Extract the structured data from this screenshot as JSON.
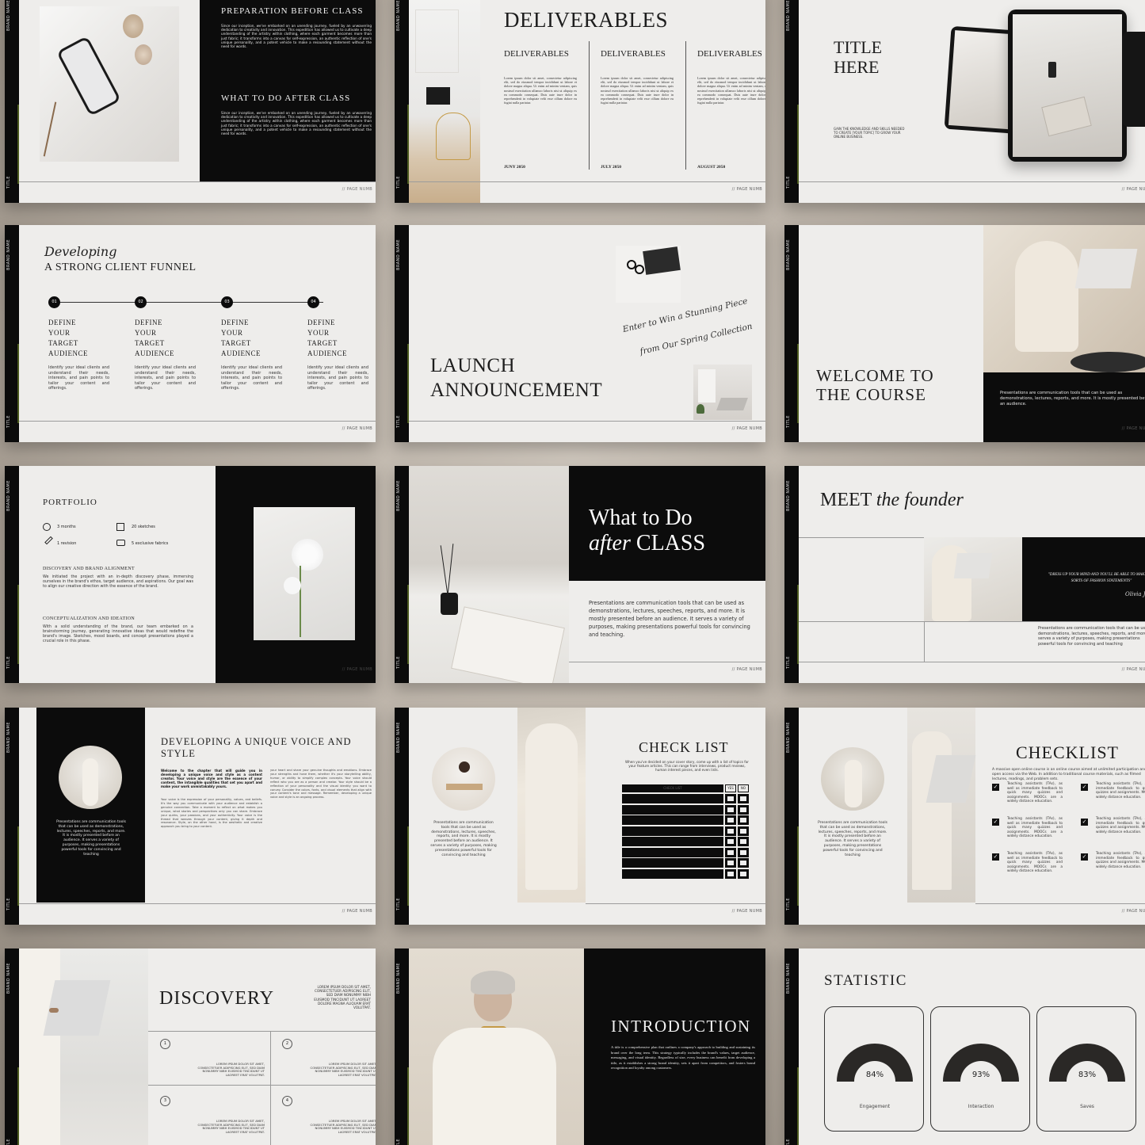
{
  "common": {
    "brand": "BRAND NAME",
    "title": "TITLE",
    "page": "// PAGE NUMB"
  },
  "s1": {
    "h1": "PREPARATION BEFORE CLASS",
    "h2": "WHAT TO DO AFTER CLASS",
    "body": "Since our inception, we've embarked on an unending journey, fueled by an unwavering dedication to creativity and innovation. This expedition has allowed us to cultivate a deep understanding of the artistry within clothing, where each garment becomes more than just fabric; it transforms into a canvas for self-expression, an authentic reflection of one's unique personality, and a potent vehicle to make a resounding statement without the need for words."
  },
  "s2": {
    "title": "DELIVERABLES",
    "cols": [
      {
        "h": "DELIVERABLES",
        "date": "JUNY 2050"
      },
      {
        "h": "DELIVERABLES",
        "date": "JULY 2050"
      },
      {
        "h": "DELIVERABLES",
        "date": "AUGUST 2050"
      }
    ],
    "body": "Lorem ipsum dolor sit amet, consectetur adipiscing elit, sed do eiusmod tempor incididunt ut labore et dolore magna aliqua. Ut enim ad minim veniam, quis nostrud exercitation ullamco laboris nisi ut aliquip ex ea commodo consequat. Duis aute irure dolor in reprehenderit in voluptate velit esse cillum dolore eu fugiat nulla pariatur."
  },
  "s3": {
    "title1": "TITLE",
    "title2": "HERE",
    "body": "GAIN THE KNOWLEDGE AND SKILLS NEEDED TO CREATE [YOUR TOPIC] TO GROW YOUR ONLINE BUSINESS."
  },
  "s4": {
    "script": "Developing",
    "title": "A STRONG CLIENT FUNNEL",
    "steps": [
      {
        "n": "01",
        "h": "DEFINE YOUR TARGET AUDIENCE",
        "b": "Identify your ideal clients and understand their needs, interests, and pain points to tailor your content and offerings."
      },
      {
        "n": "02",
        "h": "DEFINE YOUR TARGET AUDIENCE",
        "b": "Identify your ideal clients and understand their needs, interests, and pain points to tailor your content and offerings."
      },
      {
        "n": "03",
        "h": "DEFINE YOUR TARGET AUDIENCE",
        "b": "Identify your ideal clients and understand their needs, interests, and pain points to tailor your content and offerings."
      },
      {
        "n": "04",
        "h": "DEFINE YOUR TARGET AUDIENCE",
        "b": "Identify your ideal clients and understand their needs, interests, and pain points to tailor your content and offerings."
      }
    ]
  },
  "s5": {
    "title1": "LAUNCH",
    "title2": "ANNOUNCEMENT",
    "script1": "Enter to Win a Stunning Piece",
    "script2": "from Our Spring Collection"
  },
  "s6": {
    "title1": "WELCOME TO",
    "title2": "THE COURSE",
    "body": "Presentations are communication tools that can be used as demonstrations, lectures, reports, and more. It is mostly presented before an audience."
  },
  "s7": {
    "title": "PORTFOLIO",
    "stats": [
      "3 months",
      "20 sketches",
      "1 revision",
      "5 exclusive fabrics"
    ],
    "h1": "DISCOVERY AND BRAND ALIGNMENT",
    "b1": "We initiated the project with an in-depth discovery phase, immersing ourselves in the brand's ethos, target audience, and aspirations. Our goal was to align our creative direction with the essence of the brand.",
    "h2": "CONCEPTUALIZATION AND IDEATION",
    "b2": "With a solid understanding of the brand, our team embarked on a brainstorming journey, generating innovative ideas that would redefine the brand's image. Sketches, mood boards, and concept presentations played a crucial role in this phase."
  },
  "s8": {
    "t1": "What to Do",
    "t2a": "after",
    "t2b": " CLASS",
    "body": "Presentations are communication tools that can be used as demonstrations, lectures, speeches, reports, and more. It is mostly presented before an audience. It serves a variety of purposes, making presentations powerful tools for convincing and teaching."
  },
  "s9": {
    "t1": "MEET ",
    "t2": "the founder",
    "quote": "\"DRESS UP YOUR MIND AND YOU'LL BE ABLE TO MAKE ALL SORTS OF FASHION STATEMENTS\"",
    "sig": "Olivia Jones",
    "body": "Presentations are communication tools that can be used as demonstrations, lectures, speeches, reports, and more. It serves a variety of purposes, making presentations powerful tools for convincing and teaching"
  },
  "s10": {
    "title": "DEVELOPING A UNIQUE VOICE AND STYLE",
    "caption": "Presentations are communication tools that can be used as demonstrations, lectures, speeches, reports, and more. It is mostly presented before an audience. It serves a variety of purposes, making presentations powerful tools for convincing and teaching",
    "lead": "Welcome to the chapter that will guide you in developing a unique voice and style as a content creator. Your voice and style are the essence of your content, the intangible qualities that set you apart and make your work unmistakably yours.",
    "body": "Your voice is the expression of your personality, values, and beliefs. It's the way you communicate with your audience and establish a genuine connection. Take a moment to reflect on what makes you unique, what stories and perspectives only you can share. Embrace your quirks, your passions, and your authenticity. Your voice is the thread that weaves through your content, giving it depth and resonance. Style, on the other hand, is the aesthetic and creative approach you bring to your content.",
    "body2": "your heart and share your genuine thoughts and emotions. Embrace your strengths and hone them, whether it's your storytelling ability, humor, or ability to simplify complex concepts. Your voice should reflect who you are as a person and creator. Your style should be a reflection of your personality and the visual identity you want to convey. Consider the colors, fonts, and visual elements that align with your content's tone and message. Remember, developing a unique voice and style is an ongoing process."
  },
  "s11": {
    "title": "CHECK LIST",
    "sub": "When you've decided on your cover story, come up with a list of topics for your feature articles. This can range from interviews, product reviews, human interest pieces, and even lists.",
    "caption": "Presentations are communication tools that can be used as demonstrations, lectures, speeches, reports, and more. It is mostly presented before an audience. It serves a variety of purposes, making presentations powerful tools for convincing and teaching",
    "col": "CHECK LIST",
    "yes": "YES",
    "no": "NO"
  },
  "s12": {
    "title": "CHECKLIST",
    "sub": "A massive open online course is an online course aimed at unlimited participation and open access via the Web. In addition to traditional course materials, such as filmed lectures, readings, and problem sets.",
    "caption": "Presentations are communication tools that can be used as demonstrations, lectures, speeches, reports, and more. It is mostly presented before an audience. It serves a variety of purposes, making presentations powerful tools for convincing and teaching",
    "item": "Teaching assistants (TAs), as well as immediate feedback to quick many quizzes and assignments. MOOCs are a widely distance education."
  },
  "s13": {
    "title": "DISCOVERY",
    "side": "LOREM IPSUM DOLOR SIT AMET, CONSECTETUER ADIPISCING ELIT, SED DIAM NONUMMY NIBH EUISMOD TINCIDUNT UT LAOREET DOLORE MAGNA ALIQUAM ERAT VOLUTPAT.",
    "cell": "LOREM IPSUM DOLOR SIT AMET, CONSECTETUER ADIPISCING ELIT, SED DIAM NONUMMY NIBH EUISMOD TINCIDUNT UT LAOREET ERAT VOLUTPAT.",
    "nums": [
      "1",
      "2",
      "3",
      "4"
    ]
  },
  "s14": {
    "title": "INTRODUCTION",
    "body": "A title is a comprehensive plan that outlines a company's approach to building and sustaining its brand over the long term. This strategy typically includes the brand's values, target audience, messaging, and visual identity. Regardless of size, every business can benefit from developing a title, as it establishes a strong brand identity, sets it apart from competitors, and fosters brand recognition and loyalty among customers."
  },
  "s15": {
    "title": "STATISTIC",
    "stats": [
      {
        "pct": 84,
        "label": "84%",
        "name": "Engagement"
      },
      {
        "pct": 93,
        "label": "93%",
        "name": "Interaction"
      },
      {
        "pct": 83,
        "label": "83%",
        "name": "Saves"
      }
    ]
  },
  "colors": {
    "black": "#0c0c0c",
    "paper": "#eeedeb",
    "accent": "#4b5a1e",
    "backdrop": "#b8b0a6"
  }
}
